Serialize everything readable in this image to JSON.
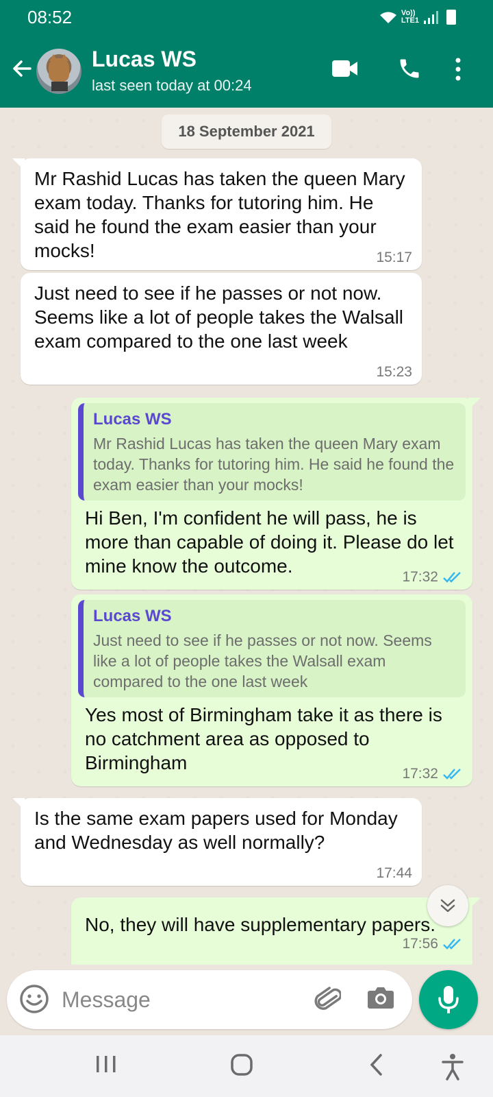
{
  "status_bar": {
    "time": "08:52",
    "network": "Vo))\nLTE1"
  },
  "header": {
    "contact_name": "Lucas WS",
    "last_seen": "last seen today at 00:24"
  },
  "chat": {
    "date_chip": "18 September 2021",
    "messages": [
      {
        "direction": "in",
        "text": "Mr Rashid Lucas has taken the queen Mary exam today. Thanks for tutoring him. He said he found the exam easier than your mocks!",
        "time": "15:17"
      },
      {
        "direction": "in",
        "text": "Just need to see if he passes or not now.  Seems like a lot of people takes the Walsall exam compared to the one last week",
        "time": "15:23"
      },
      {
        "direction": "out",
        "quote_author": "Lucas WS",
        "quote_text": "Mr Rashid Lucas has taken the queen Mary exam today. Thanks for tutoring him. He said he found the exam easier than your mocks!",
        "text": "Hi Ben, I'm confident he will pass, he is more than capable of doing it. Please do let mine know the outcome.",
        "time": "17:32",
        "status": "read"
      },
      {
        "direction": "out",
        "quote_author": "Lucas WS",
        "quote_text": "Just need to see if he passes or not now. Seems like a lot of people takes the Walsall exam compared to the one last week",
        "text": "Yes most of Birmingham take it as there is no catchment area as opposed to Birmingham",
        "time": "17:32",
        "status": "read"
      },
      {
        "direction": "in",
        "text": "Is the same exam papers used for Monday and Wednesday as well normally?",
        "time": "17:44"
      },
      {
        "direction": "out",
        "text": "No, they will have supplementary papers.",
        "time": "17:56",
        "status": "read"
      }
    ]
  },
  "input": {
    "placeholder": "Message"
  },
  "icons": {
    "back": "arrow-left-icon",
    "video": "video-camera-icon",
    "call": "phone-icon",
    "menu": "more-vertical-icon",
    "emoji": "smiley-icon",
    "attach": "paperclip-icon",
    "camera": "camera-icon",
    "mic": "microphone-icon",
    "scroll": "double-chevron-down-icon",
    "read": "double-check-icon"
  },
  "colors": {
    "brand": "#008069",
    "accent": "#00a884",
    "outgoing_bubble": "#e7fdd8",
    "quote_bar": "#5a48d1",
    "read_tick": "#34b7f1"
  }
}
